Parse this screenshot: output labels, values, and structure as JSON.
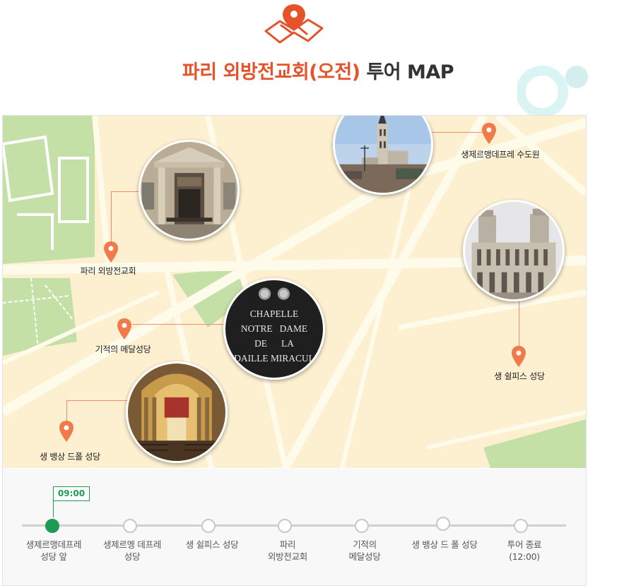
{
  "header": {
    "icon": "map-pin-icon",
    "title_accent": "파리 외방전교회(오전)",
    "title_rest": " 투어 MAP"
  },
  "colors": {
    "accent": "#e5532b",
    "map_bg": "#fdf0d0",
    "map_road": "#fffbeb",
    "map_park": "#c5e0a6",
    "pin": "#f07a4a",
    "timeline_active": "#1e9a57"
  },
  "map": {
    "places": [
      {
        "label": "생제르맹데프레 수도원",
        "photo": "saint-germain-des-pres-abbey-photo"
      },
      {
        "label": "파리 외방전교회",
        "photo": "missions-etrangeres-de-paris-photo"
      },
      {
        "label": "생 쉴피스 성당",
        "photo": "saint-sulpice-church-photo"
      },
      {
        "label": "기적의 메달성당",
        "photo": "chapelle-notre-dame-medaille-miraculeuse-photo"
      },
      {
        "label": "생 뱅상 드폴 성당",
        "photo": "saint-vincent-de-paul-chapel-photo"
      }
    ],
    "sign_text": {
      "line1": "CHAPELLE",
      "line2": "NOTRE   DAME",
      "line3": "DE      LA",
      "line4": "EDAILLE MIRACULE"
    }
  },
  "timeline": {
    "start_time": "09:00",
    "stops": [
      {
        "line1": "생제르맹데프레",
        "line2": "성당 앞",
        "active": true
      },
      {
        "line1": "생제르멩 데프레",
        "line2": "성당",
        "active": false
      },
      {
        "line1": "생 쉴피스 성당",
        "line2": "",
        "active": false
      },
      {
        "line1": "파리",
        "line2": "외방전교회",
        "active": false
      },
      {
        "line1": "기적의",
        "line2": "메달성당",
        "active": false
      },
      {
        "line1": "생 뱅상 드 폴 성당",
        "line2": "",
        "active": false
      },
      {
        "line1": "투어 종료",
        "line2": "(12:00)",
        "active": false
      }
    ]
  }
}
